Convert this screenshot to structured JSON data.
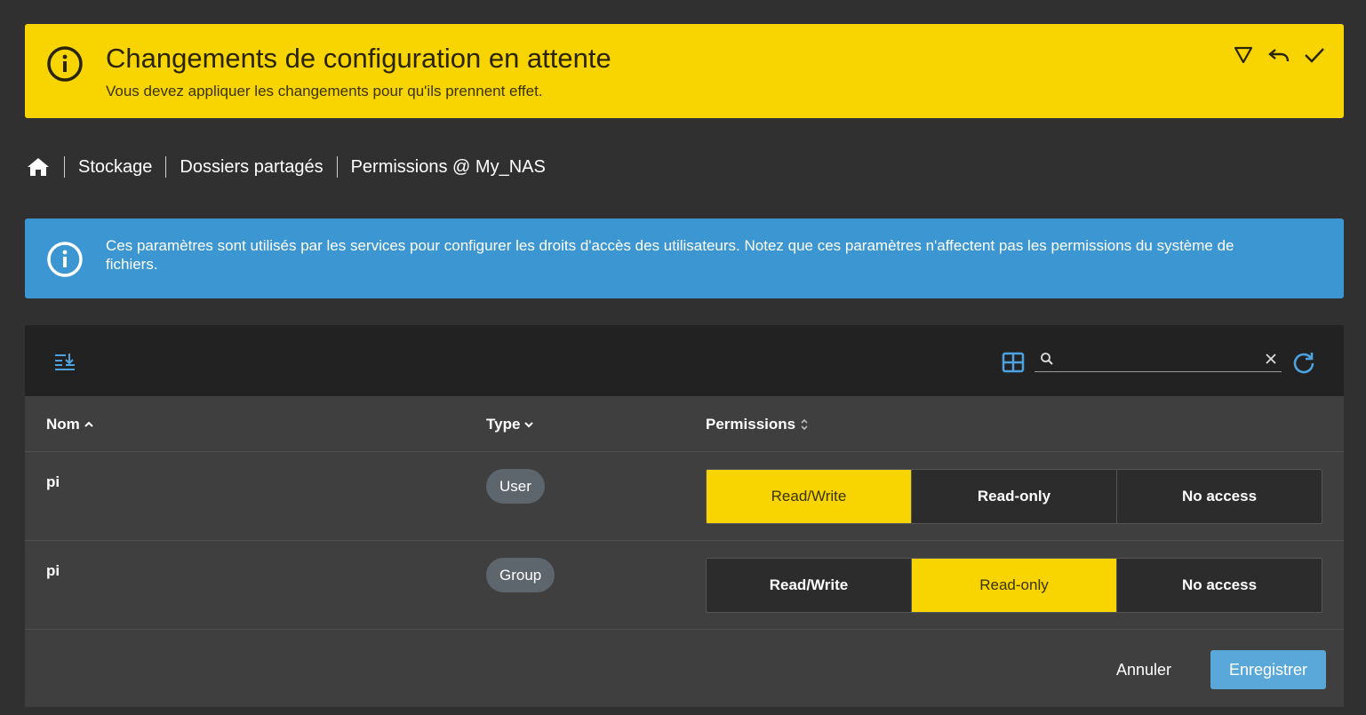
{
  "banner": {
    "title": "Changements de configuration en attente",
    "subtitle": "Vous devez appliquer les changements pour qu'ils prennent effet.",
    "actions": [
      "filter-icon",
      "undo-icon",
      "check-icon"
    ],
    "color": "#f8d400"
  },
  "breadcrumb": {
    "home_icon": "home-icon",
    "items": [
      "Stockage",
      "Dossiers partagés",
      "Permissions @ My_NAS"
    ]
  },
  "info": {
    "text": "Ces paramètres sont utilisés par les services pour configurer les droits d'accès des utilisateurs. Notez que ces paramètres n'affectent pas les permissions du système de fichiers.",
    "color": "#3c96d2"
  },
  "toolbar": {
    "search_value": "",
    "icons": [
      "column-settings-icon",
      "grid-view-icon",
      "search-icon",
      "clear-icon",
      "refresh-icon"
    ]
  },
  "table": {
    "columns": [
      {
        "label": "Nom",
        "sort": "asc"
      },
      {
        "label": "Type",
        "sort": "desc"
      },
      {
        "label": "Permissions",
        "sort": "none"
      }
    ],
    "permission_options": [
      "Read/Write",
      "Read-only",
      "No access"
    ],
    "rows": [
      {
        "name": "pi",
        "type": "User",
        "permission": "Read/Write"
      },
      {
        "name": "pi",
        "type": "Group",
        "permission": "Read-only"
      }
    ]
  },
  "footer": {
    "cancel_label": "Annuler",
    "save_label": "Enregistrer"
  }
}
